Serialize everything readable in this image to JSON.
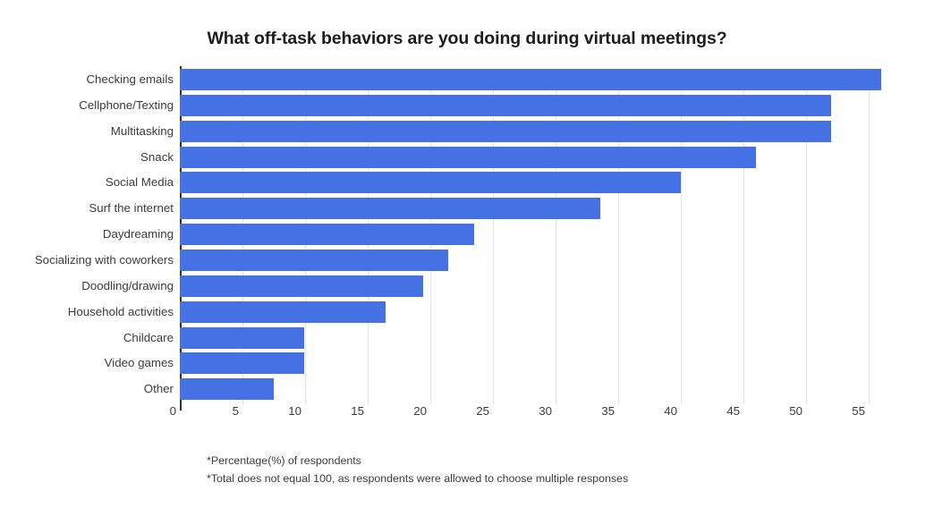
{
  "chart_data": {
    "type": "bar",
    "orientation": "horizontal",
    "title": "What off-task behaviors are you doing during virtual meetings?",
    "xlabel": "",
    "ylabel": "",
    "xlim": [
      0,
      56.8
    ],
    "xticks": [
      0,
      5,
      10,
      15,
      20,
      25,
      30,
      35,
      40,
      45,
      50,
      55
    ],
    "xtick_labels": [
      "0",
      "5",
      "10",
      "15",
      "20",
      "25",
      "30",
      "35",
      "40",
      "45",
      "50",
      "55"
    ],
    "grid": true,
    "grid_axis": "x",
    "legend": false,
    "bar_color": "#4472e4",
    "categories": [
      "Checking emails",
      "Cellphone/Texting",
      "Multitasking",
      "Snack",
      "Social Media",
      "Surf the internet",
      "Daydreaming",
      "Socializing with coworkers",
      "Doodling/drawing",
      "Household activities",
      "Childcare",
      "Video games",
      "Other"
    ],
    "values": [
      56,
      52,
      52,
      46,
      40,
      33.6,
      23.5,
      21.4,
      19.4,
      16.4,
      9.9,
      9.9,
      7.5
    ],
    "annotations": [
      "*Percentage(%) of respondents",
      "*Total does not equal 100, as respondents were allowed to choose multiple responses"
    ]
  },
  "footnotes": {
    "line1": "*Percentage(%) of respondents",
    "line2": "*Total does not equal 100, as respondents were allowed to choose multiple responses"
  },
  "colors": {
    "bar": "#4472e4",
    "text": "#3c3c3c",
    "title": "#1d1d1d",
    "grid": "#e3e3e3",
    "axis": "#333333",
    "background": "#ffffff"
  }
}
